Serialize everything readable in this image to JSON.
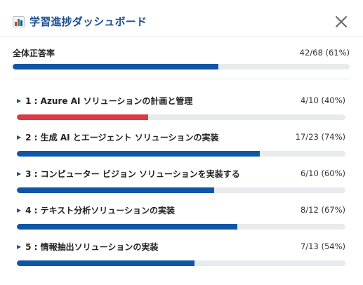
{
  "header": {
    "title": "学習進捗ダッシュボード",
    "icon": "bar-chart-icon",
    "close_icon": "close-icon"
  },
  "overall": {
    "label": "全体正答率",
    "stat": "42/68 (61%)",
    "fraction": 0.61,
    "color": "#0f56a8"
  },
  "sections": [
    {
      "title": "1 : Azure AI ソリューションの計画と管理",
      "stat": "4/10 (40%)",
      "fraction": 0.4,
      "color": "#d93b47"
    },
    {
      "title": "2 : 生成 AI とエージェント ソリューションの実装",
      "stat": "17/23 (74%)",
      "fraction": 0.74,
      "color": "#0f56a8"
    },
    {
      "title": "3 : コンピューター ビジョン ソリューションを実装する",
      "stat": "6/10 (60%)",
      "fraction": 0.6,
      "color": "#0f56a8"
    },
    {
      "title": "4 : テキスト分析ソリューションの実装",
      "stat": "8/12 (67%)",
      "fraction": 0.67,
      "color": "#0f56a8"
    },
    {
      "title": "5 : 情報抽出ソリューションの実装",
      "stat": "7/13 (54%)",
      "fraction": 0.54,
      "color": "#0f56a8"
    }
  ],
  "section_marker": "▶"
}
